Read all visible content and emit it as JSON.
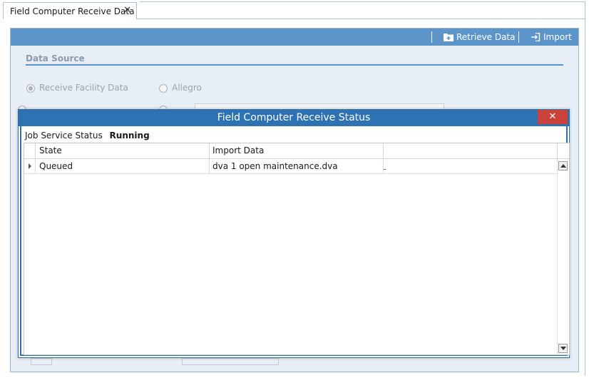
{
  "tab": {
    "label": "Field Computer Receive Data",
    "close_glyph": "✕"
  },
  "toolbar": {
    "retrieve_label": "Retrieve Data",
    "import_label": "Import"
  },
  "data_source": {
    "title": "Data Source",
    "options": [
      {
        "label": "Receive Facility Data",
        "checked": true
      },
      {
        "label": "Allegro",
        "checked": false
      }
    ]
  },
  "dialog": {
    "title": "Field Computer Receive Status",
    "close_glyph": "✕",
    "job_status_label": "Job Service Status",
    "job_status_value": "Running",
    "grid": {
      "columns": [
        "State",
        "Import Data",
        ""
      ],
      "rows": [
        {
          "state": "Queued",
          "import_data": "dva 1 open maintenance.dva"
        }
      ]
    }
  },
  "colors": {
    "accent": "#2d73b3",
    "toolbar": "#5b95c9",
    "close": "#c9433a"
  }
}
